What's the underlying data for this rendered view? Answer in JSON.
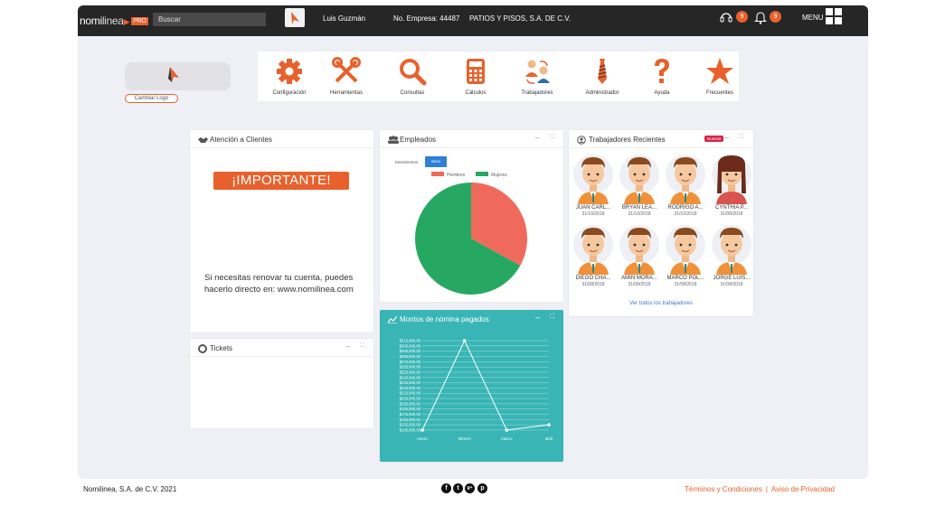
{
  "topbar": {
    "logo_main": "nomi",
    "logo_light": "linea",
    "logo_pro": "PRO",
    "search_placeholder": "Buscar",
    "user_name": "Luis Guzmán",
    "company_label": "No. Empresa: 44487",
    "company_name": "PATIOS Y PISOS, S.A. DE C.V.",
    "support_count": "9",
    "notifications_count": "9",
    "menu_label": "MENU"
  },
  "logo_area": {
    "change_logo_label": "Cambiar Logo"
  },
  "modules": [
    {
      "label": "Configuración",
      "icon": "gear-icon"
    },
    {
      "label": "Herramientas",
      "icon": "tools-icon"
    },
    {
      "label": "Consultas",
      "icon": "search-icon"
    },
    {
      "label": "Cálculos",
      "icon": "calculator-icon"
    },
    {
      "label": "Trabajadores",
      "icon": "workers-icon"
    },
    {
      "label": "Administrador",
      "icon": "tie-icon"
    },
    {
      "label": "Ayuda",
      "icon": "question-icon"
    },
    {
      "label": "Frecuentes",
      "icon": "star-icon"
    }
  ],
  "attention_panel": {
    "title": "Atención a Clientes",
    "important_label": "¡IMPORTANTE!",
    "renew_text": "Si necesitas renovar tu cuenta, puedes hacerlo directo en: www.nomilinea.com"
  },
  "tickets_panel": {
    "title": "Tickets"
  },
  "employees_panel": {
    "title": "Empleados",
    "filter_label": "Movimientos",
    "filter_button": "Sexo"
  },
  "payroll_panel": {
    "title": "Montos de nómina pagados"
  },
  "recent_workers_panel": {
    "title": "Trabajadores Recientes",
    "new_tag": "Nuevos",
    "see_all": "Ver todos los trabajadores",
    "workers": [
      {
        "name": "JUAN CARL...",
        "date": "31/10/2018",
        "gender": "m"
      },
      {
        "name": "BRYAN LEA...",
        "date": "31/10/2018",
        "gender": "m"
      },
      {
        "name": "RODRIGO A...",
        "date": "31/10/2018",
        "gender": "m"
      },
      {
        "name": "CYNTHIA P...",
        "date": "31/08/2018",
        "gender": "f"
      },
      {
        "name": "DIEGO CHA...",
        "date": "31/08/2018",
        "gender": "m"
      },
      {
        "name": "AMIN MORA...",
        "date": "31/08/2018",
        "gender": "m"
      },
      {
        "name": "MARCO POL...",
        "date": "31/08/2018",
        "gender": "m"
      },
      {
        "name": "JORGE LUIS...",
        "date": "31/08/2018",
        "gender": "m"
      }
    ]
  },
  "footer": {
    "company": "Nomilinea, S.A. de C.V.  2021",
    "terms": "Términos y Condiciones",
    "separator": "|",
    "privacy": "Aviso de Privacidad",
    "social": [
      "f",
      "t",
      "g+",
      "p"
    ]
  },
  "colors": {
    "accent": "#e8612c",
    "dark": "#262626",
    "teal": "#39b5b5",
    "male": "#f06a5c",
    "female": "#27a862"
  },
  "chart_data": [
    {
      "type": "pie",
      "title": "",
      "legend": [
        "Hombres",
        "Mujeres"
      ],
      "values": [
        33,
        67
      ],
      "colors": [
        "#f06a5c",
        "#27a862"
      ]
    },
    {
      "type": "line",
      "title": "Montos de nómina pagados",
      "categories": [
        "enero",
        "febrero",
        "marzo",
        "abril"
      ],
      "values": [
        145000,
        315000,
        145000,
        155000
      ],
      "yticks": [
        "$315,000.00",
        "$305,000.00",
        "$295,000.00",
        "$285,000.00",
        "$275,000.00",
        "$265,000.00",
        "$255,000.00",
        "$245,000.00",
        "$235,000.00",
        "$225,000.00",
        "$215,000.00",
        "$205,000.00",
        "$195,000.00",
        "$185,000.00",
        "$175,000.00",
        "$165,000.00",
        "$155,000.00",
        "$145,000.00"
      ],
      "ylim": [
        145000,
        315000
      ]
    }
  ]
}
